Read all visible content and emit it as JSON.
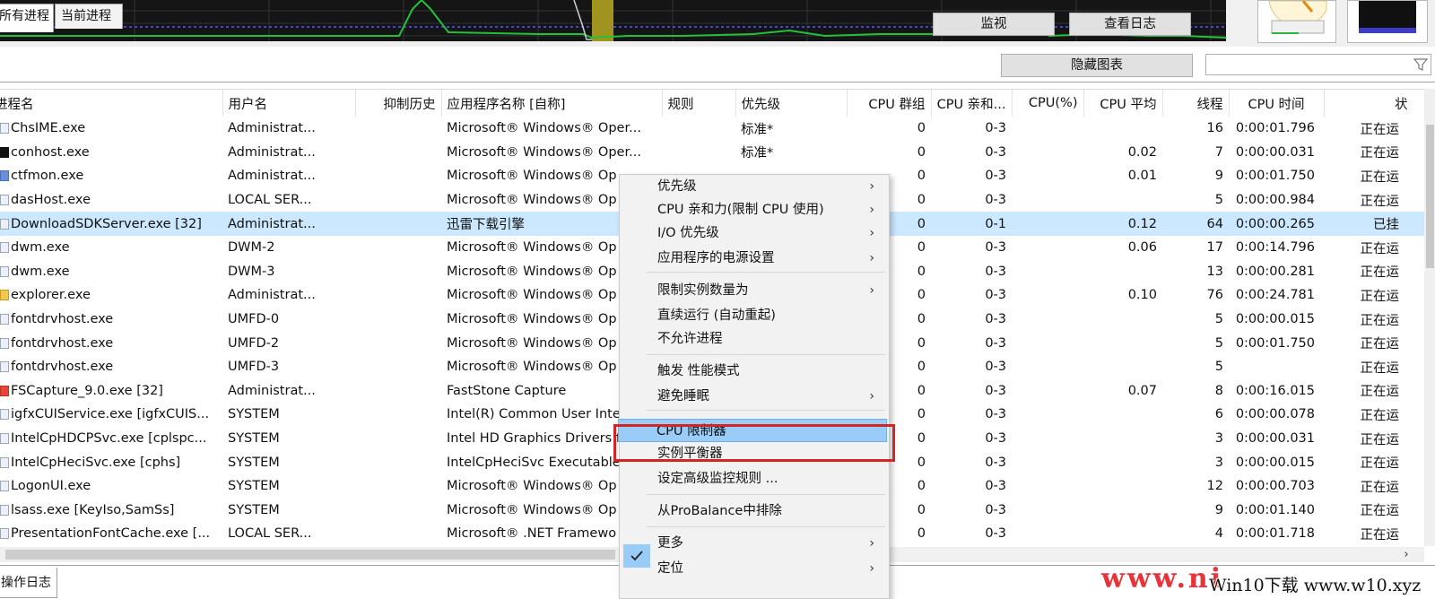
{
  "tabs": {
    "all": "所有进程",
    "current": "当前进程"
  },
  "toolbar": {
    "hide_graph": "隐藏图表",
    "filter_placeholder": ""
  },
  "columns": [
    "进程名",
    "用户名",
    "抑制历史",
    "应用程序名称 [自称]",
    "规则",
    "优先级",
    "CPU 群组",
    "CPU 亲和...",
    "CPU(%)",
    "CPU 平均",
    "线程",
    "CPU 时间",
    "状"
  ],
  "rows": [
    {
      "icon": "default",
      "name": "ChsIME.exe",
      "user": "Administrat...",
      "hist": "",
      "app": "Microsoft® Windows® Oper...",
      "rule": "",
      "prio": "标准*",
      "group": "0",
      "aff": "0-3",
      "cpu": "",
      "avg": "",
      "threads": "16",
      "time": "0:00:01.796",
      "state": "正在运"
    },
    {
      "icon": "black",
      "name": "conhost.exe",
      "user": "Administrat...",
      "hist": "",
      "app": "Microsoft® Windows® Oper...",
      "rule": "",
      "prio": "标准*",
      "group": "0",
      "aff": "0-3",
      "cpu": "",
      "avg": "0.02",
      "threads": "7",
      "time": "0:00:00.031",
      "state": "正在运"
    },
    {
      "icon": "blue",
      "name": "ctfmon.exe",
      "user": "Administrat...",
      "hist": "",
      "app": "Microsoft® Windows® Op",
      "rule": "",
      "prio": "",
      "group": "0",
      "aff": "0-3",
      "cpu": "",
      "avg": "0.01",
      "threads": "9",
      "time": "0:00:01.750",
      "state": "正在运"
    },
    {
      "icon": "default",
      "name": "dasHost.exe",
      "user": "LOCAL SER...",
      "hist": "",
      "app": "Microsoft® Windows® Op",
      "rule": "",
      "prio": "",
      "group": "0",
      "aff": "0-3",
      "cpu": "",
      "avg": "",
      "threads": "5",
      "time": "0:00:00.984",
      "state": "正在运"
    },
    {
      "icon": "default",
      "name": "DownloadSDKServer.exe [32]",
      "user": "Administrat...",
      "hist": "",
      "app": "迅雷下载引擎",
      "rule": "",
      "prio": "",
      "group": "0",
      "aff": "0-1",
      "cpu": "",
      "avg": "0.12",
      "threads": "64",
      "time": "0:00:00.265",
      "state": "已挂"
    },
    {
      "icon": "default",
      "name": "dwm.exe",
      "user": "DWM-2",
      "hist": "",
      "app": "Microsoft® Windows® Op",
      "rule": "",
      "prio": "",
      "group": "0",
      "aff": "0-3",
      "cpu": "",
      "avg": "0.06",
      "threads": "17",
      "time": "0:00:14.796",
      "state": "正在运"
    },
    {
      "icon": "default",
      "name": "dwm.exe",
      "user": "DWM-3",
      "hist": "",
      "app": "Microsoft® Windows® Op",
      "rule": "",
      "prio": "",
      "group": "0",
      "aff": "0-3",
      "cpu": "",
      "avg": "",
      "threads": "13",
      "time": "0:00:00.281",
      "state": "正在运"
    },
    {
      "icon": "yellow",
      "name": "explorer.exe",
      "user": "Administrat...",
      "hist": "",
      "app": "Microsoft® Windows® Op",
      "rule": "",
      "prio": "",
      "group": "0",
      "aff": "0-3",
      "cpu": "",
      "avg": "0.10",
      "threads": "76",
      "time": "0:00:24.781",
      "state": "正在运"
    },
    {
      "icon": "default",
      "name": "fontdrvhost.exe",
      "user": "UMFD-0",
      "hist": "",
      "app": "Microsoft® Windows® Op",
      "rule": "",
      "prio": "",
      "group": "0",
      "aff": "0-3",
      "cpu": "",
      "avg": "",
      "threads": "5",
      "time": "0:00:00.015",
      "state": "正在运"
    },
    {
      "icon": "default",
      "name": "fontdrvhost.exe",
      "user": "UMFD-2",
      "hist": "",
      "app": "Microsoft® Windows® Op",
      "rule": "",
      "prio": "",
      "group": "0",
      "aff": "0-3",
      "cpu": "",
      "avg": "",
      "threads": "5",
      "time": "0:00:01.750",
      "state": "正在运"
    },
    {
      "icon": "default",
      "name": "fontdrvhost.exe",
      "user": "UMFD-3",
      "hist": "",
      "app": "Microsoft® Windows® Op",
      "rule": "",
      "prio": "",
      "group": "0",
      "aff": "0-3",
      "cpu": "",
      "avg": "",
      "threads": "5",
      "time": "",
      "state": "正在运"
    },
    {
      "icon": "red",
      "name": "FSCapture_9.0.exe [32]",
      "user": "Administrat...",
      "hist": "",
      "app": "FastStone Capture",
      "rule": "",
      "prio": "",
      "group": "0",
      "aff": "0-3",
      "cpu": "",
      "avg": "0.07",
      "threads": "8",
      "time": "0:00:16.015",
      "state": "正在运"
    },
    {
      "icon": "default",
      "name": "igfxCUIService.exe [igfxCUIS...",
      "user": "SYSTEM",
      "hist": "",
      "app": "Intel(R) Common User Inte",
      "rule": "",
      "prio": "",
      "group": "0",
      "aff": "0-3",
      "cpu": "",
      "avg": "",
      "threads": "6",
      "time": "0:00:00.078",
      "state": "正在运"
    },
    {
      "icon": "default",
      "name": "IntelCpHDCPSvc.exe [cplspc...",
      "user": "SYSTEM",
      "hist": "",
      "app": "Intel HD Graphics Drivers f",
      "rule": "",
      "prio": "",
      "group": "0",
      "aff": "0-3",
      "cpu": "",
      "avg": "",
      "threads": "3",
      "time": "0:00:00.031",
      "state": "正在运"
    },
    {
      "icon": "default",
      "name": "IntelCpHeciSvc.exe [cphs]",
      "user": "SYSTEM",
      "hist": "",
      "app": "IntelCpHeciSvc Executable",
      "rule": "",
      "prio": "",
      "group": "0",
      "aff": "0-3",
      "cpu": "",
      "avg": "",
      "threads": "3",
      "time": "0:00:00.015",
      "state": "正在运"
    },
    {
      "icon": "default",
      "name": "LogonUI.exe",
      "user": "SYSTEM",
      "hist": "",
      "app": "Microsoft® Windows® Op",
      "rule": "",
      "prio": "",
      "group": "0",
      "aff": "0-3",
      "cpu": "",
      "avg": "",
      "threads": "12",
      "time": "0:00:00.703",
      "state": "正在运"
    },
    {
      "icon": "default",
      "name": "lsass.exe [KeyIso,SamSs]",
      "user": "SYSTEM",
      "hist": "",
      "app": "Microsoft® Windows® Op",
      "rule": "",
      "prio": "",
      "group": "0",
      "aff": "0-3",
      "cpu": "",
      "avg": "",
      "threads": "9",
      "time": "0:00:01.140",
      "state": "正在运"
    },
    {
      "icon": "default",
      "name": "PresentationFontCache.exe [...",
      "user": "LOCAL SER...",
      "hist": "",
      "app": "Microsoft® .NET Framewo",
      "rule": "",
      "prio": "",
      "group": "0",
      "aff": "0-3",
      "cpu": "",
      "avg": "",
      "threads": "4",
      "time": "0:00:01.718",
      "state": "正在运"
    }
  ],
  "menu": {
    "items": [
      {
        "label": "优先级",
        "arrow": "›"
      },
      {
        "label": "CPU 亲和力(限制 CPU 使用)",
        "arrow": "›"
      },
      {
        "label": "I/O 优先级",
        "arrow": "›"
      },
      {
        "label": "应用程序的电源设置",
        "arrow": "›"
      },
      {
        "label": "限制实例数量为",
        "arrow": "›"
      },
      {
        "label": "直续运行 (自动重起)",
        "arrow": ""
      },
      {
        "label": "不允许进程",
        "arrow": ""
      },
      {
        "label": "触发 性能模式",
        "arrow": ""
      },
      {
        "label": "避免睡眠",
        "arrow": "›"
      },
      {
        "label": "CPU 限制器",
        "arrow": ""
      },
      {
        "label": "实例平衡器",
        "arrow": ""
      },
      {
        "label": "设定高级监控规则 ...",
        "arrow": ""
      },
      {
        "label": "从ProBalance中排除",
        "arrow": ""
      },
      {
        "label": "更多",
        "arrow": "›"
      },
      {
        "label": "定位",
        "arrow": "›"
      }
    ]
  },
  "bottom": {
    "log_tab": "操作日志",
    "monitor": "监视",
    "view_log": "查看日志"
  },
  "watermark": {
    "left": "www.ni",
    "right": "Win10下载 www.w10.xyz"
  },
  "scroll": {
    "right_arrow": "›"
  },
  "colors": {
    "selected_row": "#cce8ff",
    "menu_highlight": "#99ccf7",
    "annotation_frame": "#d42424",
    "graph_line": "#22c13a"
  }
}
